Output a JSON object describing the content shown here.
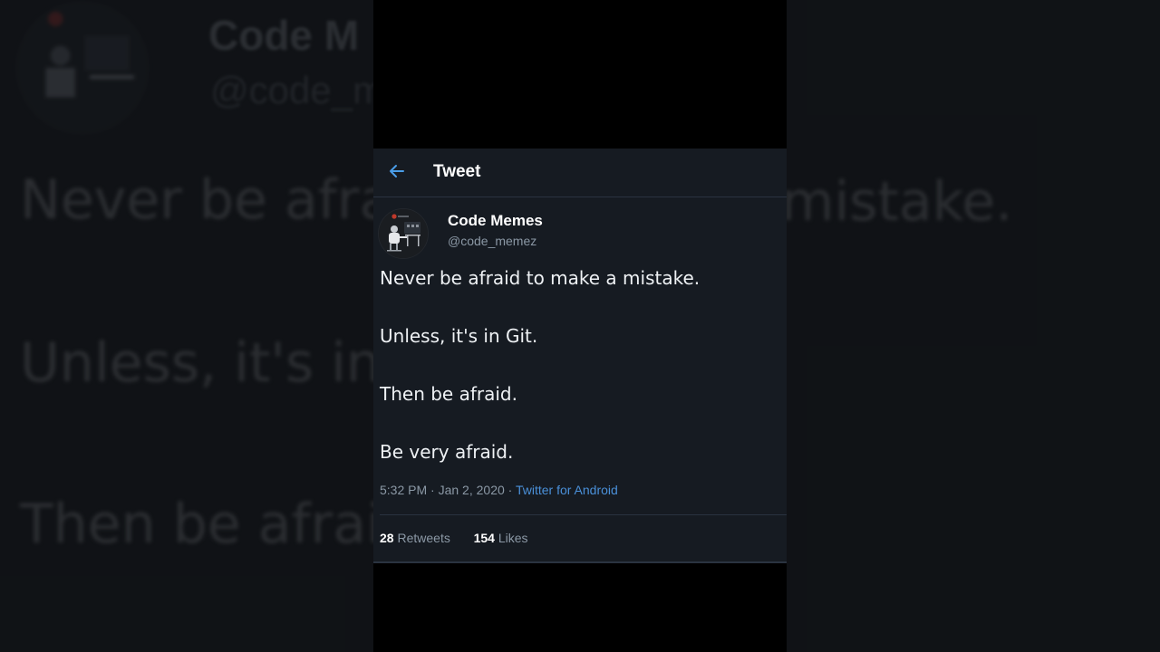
{
  "header": {
    "title": "Tweet",
    "back_icon": "arrow-left-icon",
    "accent_color": "#1d9bf0"
  },
  "author": {
    "name": "Code Memes",
    "handle": "@code_memez",
    "avatar_icon": "developer-at-desk-avatar"
  },
  "tweet": {
    "lines": [
      "Never be afraid to make a mistake.",
      "Unless, it's in Git.",
      "Then be afraid.",
      "Be very afraid."
    ],
    "time": "5:32 PM",
    "date": "Jan 2, 2020",
    "separator": "·",
    "source": "Twitter for Android"
  },
  "stats": {
    "retweets_count": "28",
    "retweets_label": "Retweets",
    "likes_count": "154",
    "likes_label": "Likes"
  },
  "background": {
    "name_fragment": "Code M",
    "handle_fragment": "@code_m",
    "line1_fragment": "Never be afra",
    "line1_right_fragment": "mistake.",
    "line2_fragment": "Unless, it's in",
    "line3_fragment": "Then be afrai"
  }
}
